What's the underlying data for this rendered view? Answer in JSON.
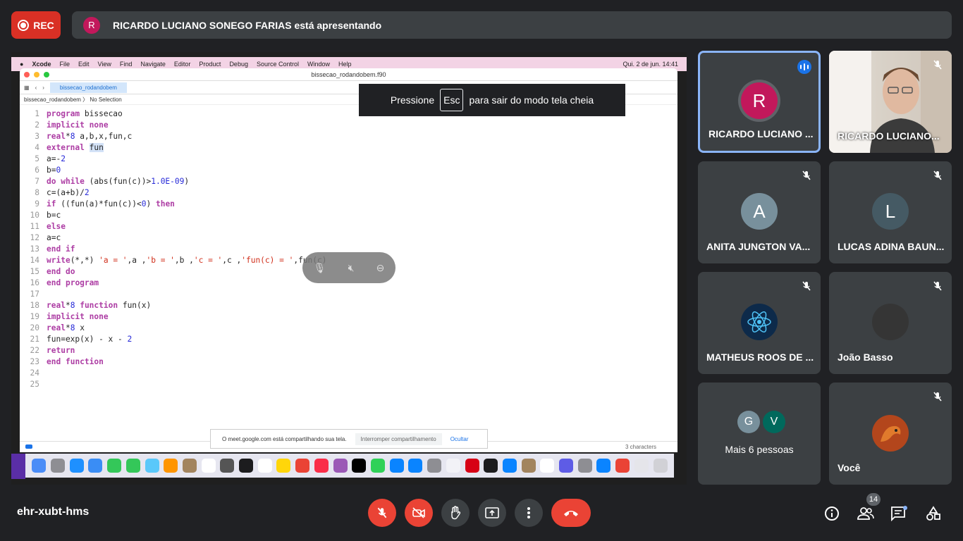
{
  "rec_label": "REC",
  "presenter": {
    "initial": "R",
    "text": "RICARDO LUCIANO SONEGO FARIAS está apresentando"
  },
  "fullscreen_hint": {
    "before": "Pressione",
    "key": "Esc",
    "after": "para sair do modo tela cheia"
  },
  "mac_menubar": {
    "app": "Xcode",
    "items": [
      "File",
      "Edit",
      "View",
      "Find",
      "Navigate",
      "Editor",
      "Product",
      "Debug",
      "Source Control",
      "Window",
      "Help"
    ],
    "clock": "Qui. 2 de jun.  14:41"
  },
  "xcode": {
    "window_title": "bissecao_rodandobem.f90",
    "tab_label": "bissecao_rodandobem",
    "jump_bar": "bissecao_rodandobem 〉 No Selection",
    "status": "3 characters"
  },
  "code_lines": [
    "program bissecao",
    "implicit none",
    "real*8 a,b,x,fun,c",
    "external fun",
    "a=-2",
    "b=0",
    "do while (abs(fun(c))>1.0E-09)",
    "c=(a+b)/2",
    "if ((fun(a)*fun(c))<0) then",
    "b=c",
    "else",
    "a=c",
    "end if",
    "write(*,*) 'a = ',a ,'b = ',b ,'c = ',c ,'fun(c) = ',fun(c)",
    "end do",
    "end program",
    "",
    "real*8 function fun(x)",
    "implicit none",
    "real*8 x",
    "fun=exp(x) - x - 2",
    "return",
    "end function",
    "",
    ""
  ],
  "share_banner": {
    "message": "O meet.google.com está compartilhando sua tela.",
    "stop": "Interromper compartilhamento",
    "hide": "Ocultar"
  },
  "participants": [
    {
      "name": "RICARDO LUCIANO ...",
      "initial": "R",
      "color": "#c2185b",
      "speaking": true
    },
    {
      "name": "RICARDO LUCIANO...",
      "video": true,
      "muted": true
    },
    {
      "name": "ANITA JUNGTON VA...",
      "initial": "A",
      "color": "#78909c",
      "muted": true
    },
    {
      "name": "LUCAS ADINA BAUN...",
      "initial": "L",
      "color": "#455a64",
      "muted": true
    },
    {
      "name": "MATHEUS ROOS DE ...",
      "icon": "atom-avatar",
      "muted": true
    },
    {
      "name": "João Basso",
      "muted": true
    },
    {
      "name": "Mais 6 pessoas",
      "initials": [
        "G",
        "V"
      ],
      "colors": [
        "#78909c",
        "#00695c"
      ]
    },
    {
      "name": "Você",
      "icon": "dragon-avatar",
      "muted": true
    }
  ],
  "meeting_code": "ehr-xubt-hms",
  "people_count": "14",
  "colors": {
    "accent": "#8ab4f8",
    "danger": "#ea4335",
    "tile": "#3c4043",
    "background": "#202124"
  }
}
